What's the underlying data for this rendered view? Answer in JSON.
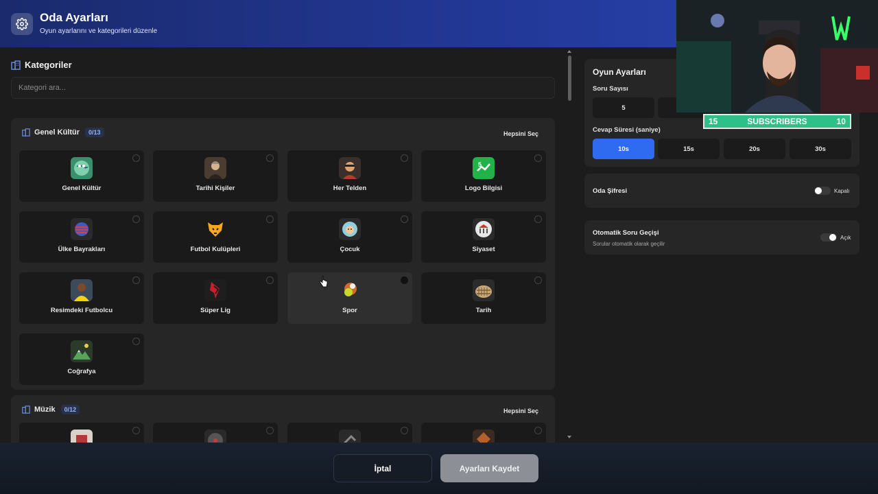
{
  "header": {
    "title": "Oda Ayarları",
    "subtitle": "Oyun ayarlarını ve kategorileri düzenle"
  },
  "categories": {
    "title": "Kategoriler",
    "search_placeholder": "Kategori ara...",
    "groups": [
      {
        "name": "Genel Kültür",
        "count": "0/13",
        "select_all": "Hepsini Seç",
        "items": [
          {
            "label": "Genel Kültür"
          },
          {
            "label": "Tarihi Kişiler"
          },
          {
            "label": "Her Telden"
          },
          {
            "label": "Logo Bilgisi"
          },
          {
            "label": "Ülke Bayrakları"
          },
          {
            "label": "Futbol Kulüpleri"
          },
          {
            "label": "Çocuk"
          },
          {
            "label": "Siyaset"
          },
          {
            "label": "Resimdeki Futbolcu"
          },
          {
            "label": "Süper Lig"
          },
          {
            "label": "Spor"
          },
          {
            "label": "Tarih"
          },
          {
            "label": "Coğrafya"
          }
        ]
      },
      {
        "name": "Müzik",
        "count": "0/12",
        "select_all": "Hepsini Seç"
      }
    ]
  },
  "settings": {
    "title": "Oyun Ayarları",
    "question_count_label": "Soru Sayısı",
    "question_count_options": [
      "5"
    ],
    "answer_time_label": "Cevap Süresi (saniye)",
    "answer_time_options": [
      "10s",
      "15s",
      "20s",
      "30s"
    ],
    "answer_time_selected": "10s",
    "room_password_label": "Oda Şifresi",
    "room_password_state": "Kapalı",
    "auto_next_label": "Otomatik Soru Geçişi",
    "auto_next_desc": "Sorular otomatik olarak geçilir",
    "auto_next_state": "Açık"
  },
  "overlay": {
    "sub_left": "15",
    "sub_text": "SUBSCRIBERS",
    "sub_right": "10"
  },
  "footer": {
    "cancel": "İptal",
    "save": "Ayarları Kaydet"
  },
  "colors": {
    "accent": "#2f6bf1",
    "header_gradient_start": "#1a2a6c",
    "header_gradient_end": "#2a44b0",
    "subscriber_banner": "#2fbf88"
  }
}
